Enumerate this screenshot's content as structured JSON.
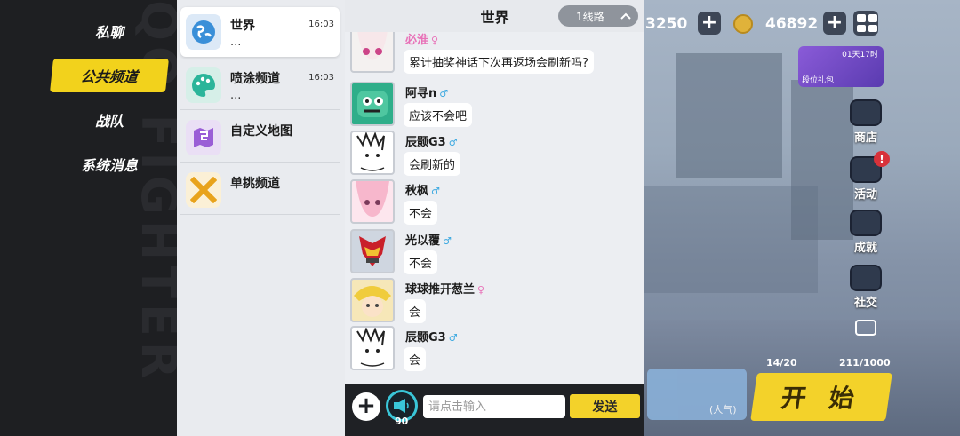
{
  "nav": {
    "items": [
      {
        "label": "私聊",
        "active": false
      },
      {
        "label": "公共频道",
        "active": true
      },
      {
        "label": "战队",
        "active": false
      },
      {
        "label": "系统消息",
        "active": false
      }
    ]
  },
  "channels": [
    {
      "name": "世界",
      "time": "16:03",
      "preview": "...",
      "icon": "globe-icon",
      "active": true
    },
    {
      "name": "喷涂频道",
      "time": "16:03",
      "preview": "...",
      "icon": "palette-icon",
      "active": false
    },
    {
      "name": "自定义地图",
      "time": "",
      "preview": "",
      "icon": "map-icon",
      "active": false
    },
    {
      "name": "单挑频道",
      "time": "",
      "preview": "",
      "icon": "crossed-swords-icon",
      "active": false
    }
  ],
  "chat": {
    "title": "世界",
    "line_selector": "1线路",
    "messages": [
      {
        "name": "必淮",
        "gender": "♀",
        "text": "累计抽奖神话下次再返场会刷新吗?"
      },
      {
        "name": "阿寻n",
        "gender": "♂",
        "text": "应该不会吧"
      },
      {
        "name": "辰颢G3",
        "gender": "♂",
        "text": "会刷新的"
      },
      {
        "name": "秋枫",
        "gender": "♂",
        "text": "不会"
      },
      {
        "name": "光以覆",
        "gender": "♂",
        "text": "不会"
      },
      {
        "name": "球球推开葱兰",
        "gender": "♀",
        "text": "会"
      },
      {
        "name": "辰颢G3",
        "gender": "♂",
        "text": "会"
      }
    ]
  },
  "input_bar": {
    "placeholder": "请点击输入",
    "send_label": "发送",
    "voice_count": "90"
  },
  "game": {
    "currency1": "3250",
    "currency2": "46892",
    "gift_timer": "01天17时",
    "gift_label": "段位礼包",
    "side_buttons": [
      "商店",
      "活动",
      "成就",
      "社交"
    ],
    "stat1": "14/20",
    "stat2": "211/1000",
    "start_label": "开 始",
    "mode_label": "(人气)"
  },
  "colors": {
    "accent_yellow": "#f2d21c",
    "male": "#3aa8e0",
    "female": "#e872b8"
  }
}
